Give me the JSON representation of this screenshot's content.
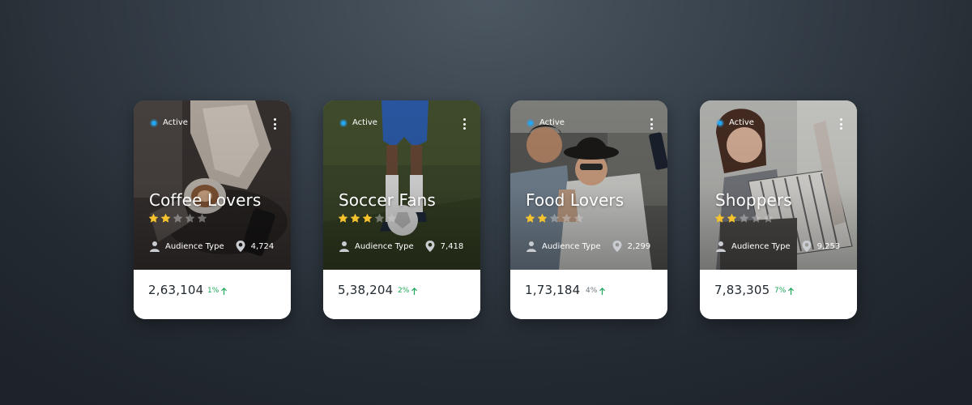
{
  "cards": [
    {
      "status": "Active",
      "title": "Coffee Lovers",
      "rating": 2,
      "audience_label": "Audience Type",
      "location_count": "4,724",
      "count": "2,63,104",
      "change": "1%",
      "change_color": "#19a657",
      "theme": "coffee"
    },
    {
      "status": "Active",
      "title": "Soccer Fans",
      "rating": 3,
      "audience_label": "Audience Type",
      "location_count": "7,418",
      "count": "5,38,204",
      "change": "2%",
      "change_color": "#19a657",
      "theme": "soccer"
    },
    {
      "status": "Active",
      "title": "Food Lovers",
      "rating": 2,
      "audience_label": "Audience Type",
      "location_count": "2,299",
      "count": "1,73,184",
      "change": "4%",
      "change_color": "#6d747a",
      "theme": "food"
    },
    {
      "status": "Active",
      "title": "Shoppers",
      "rating": 2,
      "audience_label": "Audience Type",
      "location_count": "9,253",
      "count": "7,83,305",
      "change": "7%",
      "change_color": "#19a657",
      "theme": "shopping"
    }
  ],
  "rating_max": 5,
  "colors": {
    "status_dot": "#25a5f0",
    "star_on": "#f5c32e",
    "positive": "#19a657"
  },
  "icons": {
    "status": "status-dot-icon",
    "menu": "more-vertical-icon",
    "audience": "user-icon",
    "location": "map-pin-icon",
    "trend": "arrow-up-icon"
  }
}
